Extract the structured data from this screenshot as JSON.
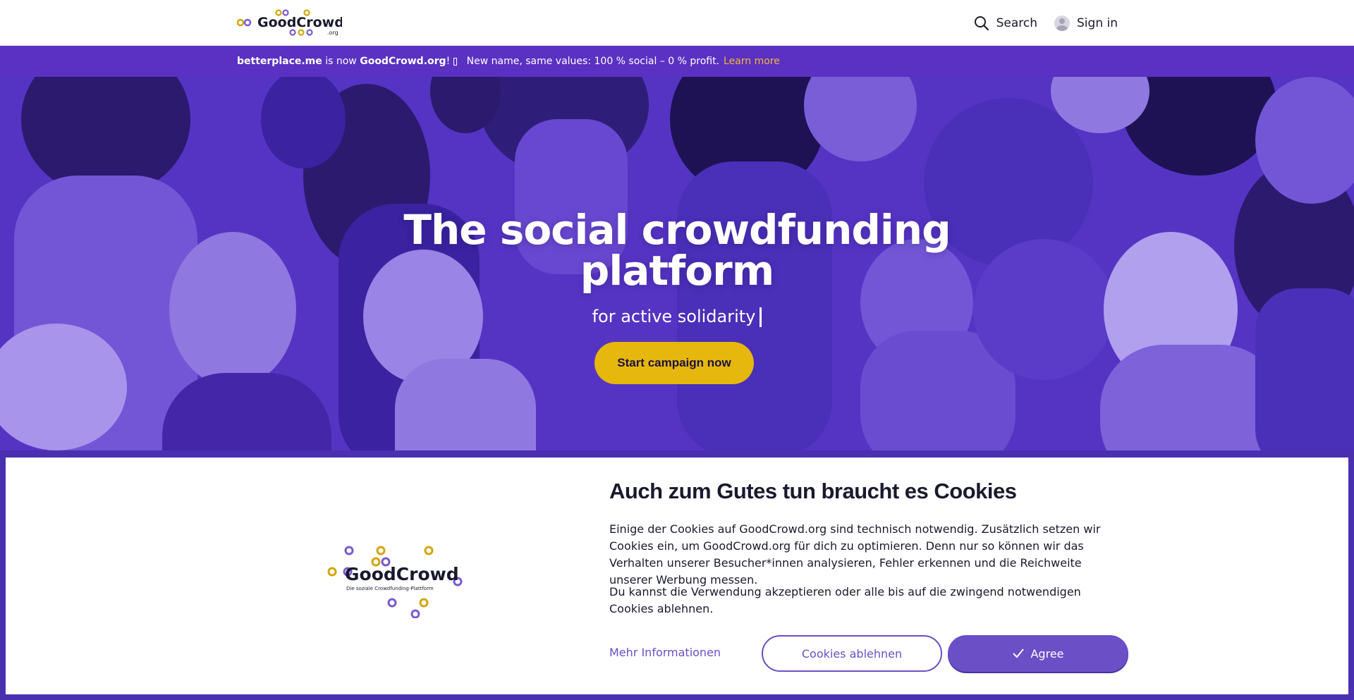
{
  "header": {
    "logo_text": "GoodCrowd",
    "logo_suffix": ".org",
    "search_label": "Search",
    "signin_label": "Sign in"
  },
  "announcement": {
    "brand_old": "betterplace.me",
    "middle": " is now ",
    "brand_new": "GoodCrowd.org",
    "after_brand": "! ",
    "emoji_placeholder": "",
    "message": "New name, same values: 100 % social – 0 % profit.",
    "learn_more": "Learn more"
  },
  "hero": {
    "title": "The social crowdfunding platform",
    "subtitle": "for active solidarity",
    "cta": "Start campaign now"
  },
  "cookie": {
    "logo_text": "GoodCrowd",
    "logo_tagline": "Die soziale Crowdfunding-Plattform",
    "title": "Auch zum Gutes tun braucht es Cookies",
    "paragraph1": "Einige der Cookies auf GoodCrowd.org sind technisch notwendig. Zusätzlich setzen wir Cookies ein, um GoodCrowd.org für dich zu optimieren. Denn nur so können wir das Verhalten unserer Besucher*innen analysieren, Fehler erkennen und die Reichweite unserer Werbung messen.",
    "paragraph2": "Du kannst die Verwendung akzeptieren oder alle bis auf die zwingend notwendigen Cookies ablehnen.",
    "more_info": "Mehr Informationen",
    "decline": "Cookies ablehnen",
    "agree": "Agree"
  },
  "colors": {
    "brand_purple": "#5a31c2",
    "accent_yellow": "#e6b70c",
    "button_purple": "#6a4fc7",
    "link_orange": "#f5b731"
  }
}
